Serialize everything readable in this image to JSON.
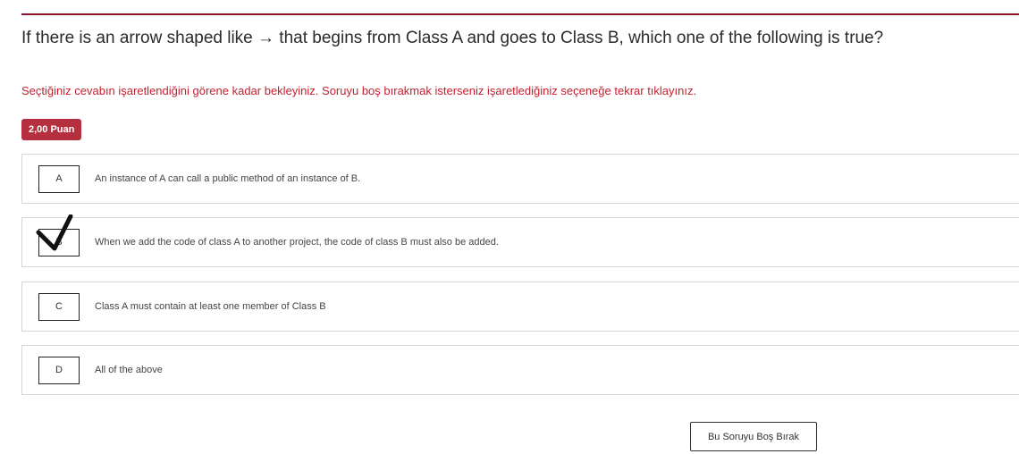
{
  "question": {
    "text": "If there is an arrow shaped like → that begins from Class A and goes to Class B, which one of the following is true?"
  },
  "instruction": "Seçtiğiniz cevabın işaretlendiğini görene kadar bekleyiniz. Soruyu boş bırakmak isterseniz işaretlediğiniz seçeneğe tekrar tıklayınız.",
  "points_badge": "2,00 Puan",
  "options": [
    {
      "letter": "A",
      "text": "An instance of A can call a public method of an instance of B.",
      "selected": false
    },
    {
      "letter": "B",
      "text": "When we add the code of class A to another project, the code of class B must also be added.",
      "selected": true
    },
    {
      "letter": "C",
      "text": "Class A must contain at least one member of Class B",
      "selected": false
    },
    {
      "letter": "D",
      "text": "All of the above",
      "selected": false
    }
  ],
  "skip_button": "Bu Soruyu Boş Bırak",
  "colors": {
    "accent_rule": "#8b1a2e",
    "instruction_text": "#c8202f",
    "badge_background": "#b5303f"
  },
  "icons": {
    "selected_marker": "check-mark-icon"
  }
}
